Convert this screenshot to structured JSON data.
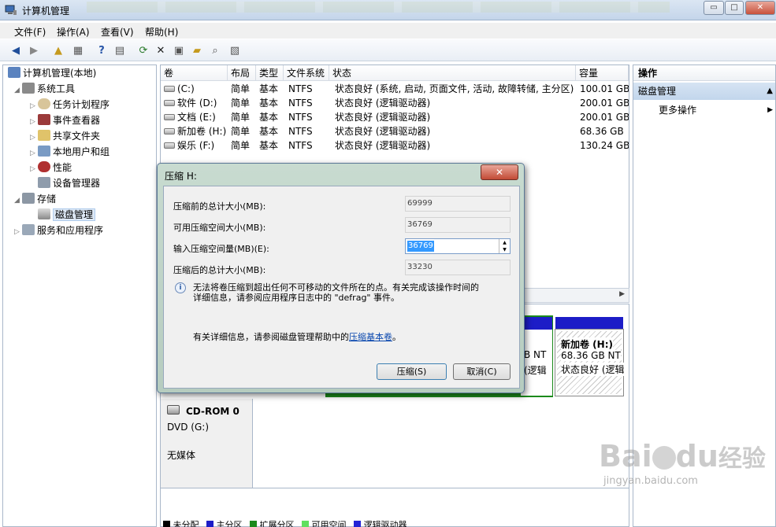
{
  "window": {
    "title": "计算机管理",
    "minimize": "▭",
    "maximize": "□",
    "close": "✕"
  },
  "menu": {
    "items": [
      "文件(F)",
      "操作(A)",
      "查看(V)",
      "帮助(H)"
    ]
  },
  "tree": {
    "root": "计算机管理(本地)",
    "system_tools": "系统工具",
    "task_scheduler": "任务计划程序",
    "event_viewer": "事件查看器",
    "shared_folders": "共享文件夹",
    "local_users": "本地用户和组",
    "performance": "性能",
    "device_manager": "设备管理器",
    "storage": "存储",
    "disk_management": "磁盘管理",
    "services_apps": "服务和应用程序"
  },
  "volumes": {
    "headers": [
      "卷",
      "布局",
      "类型",
      "文件系统",
      "状态",
      "容量"
    ],
    "rows": [
      {
        "vol": "(C:)",
        "layout": "简单",
        "type": "基本",
        "fs": "NTFS",
        "status": "状态良好 (系统, 启动, 页面文件, 活动, 故障转储, 主分区)",
        "cap": "100.01 GB"
      },
      {
        "vol": "软件 (D:)",
        "layout": "简单",
        "type": "基本",
        "fs": "NTFS",
        "status": "状态良好 (逻辑驱动器)",
        "cap": "200.01 GB"
      },
      {
        "vol": "文档 (E:)",
        "layout": "简单",
        "type": "基本",
        "fs": "NTFS",
        "status": "状态良好 (逻辑驱动器)",
        "cap": "200.01 GB"
      },
      {
        "vol": "新加卷 (H:)",
        "layout": "简单",
        "type": "基本",
        "fs": "NTFS",
        "status": "状态良好 (逻辑驱动器)",
        "cap": "68.36 GB"
      },
      {
        "vol": "娱乐 (F:)",
        "layout": "简单",
        "type": "基本",
        "fs": "NTFS",
        "status": "状态良好 (逻辑驱动器)",
        "cap": "130.24 GB"
      }
    ]
  },
  "disk_map": {
    "partial_partition": {
      "line1": "B NT",
      "line2": "(逻辑"
    },
    "new_volume": {
      "name": "新加卷  (H:)",
      "size": "68.36 GB NT",
      "status": "状态良好 (逻辑"
    },
    "cdrom": {
      "name": "CD-ROM 0",
      "drive": "DVD (G:)",
      "media": "无媒体"
    },
    "legend": [
      "未分配",
      "主分区",
      "扩展分区",
      "可用空间",
      "逻辑驱动器"
    ]
  },
  "actions": {
    "header": "操作",
    "section": "磁盘管理",
    "more": "更多操作"
  },
  "dialog": {
    "title": "压缩 H:",
    "label_total_before": "压缩前的总计大小(MB):",
    "val_total_before": "69999",
    "label_available": "可用压缩空间大小(MB):",
    "val_available": "36769",
    "label_input": "输入压缩空间量(MB)(E):",
    "input_value": "36769",
    "label_total_after": "压缩后的总计大小(MB):",
    "val_total_after": "33230",
    "info_text_1": "无法将卷压缩到超出任何不可移动的文件所在的点。有关完成该操作时间的",
    "info_text_2": "详细信息，请参阅应用程序日志中的 \"defrag\" 事件。",
    "help_text": "有关详细信息，请参阅磁盘管理帮助中的",
    "help_link": "压缩基本卷",
    "help_suffix": "。",
    "shrink_button": "压缩(S)",
    "cancel_button": "取消(C)"
  },
  "watermark": {
    "brand": "Bai",
    "brand2": "du",
    "cn": "经验",
    "url": "jingyan.baidu.com"
  }
}
